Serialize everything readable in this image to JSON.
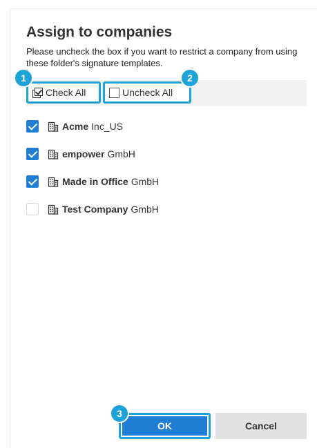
{
  "dialog": {
    "title": "Assign to companies",
    "description": "Please uncheck the box if you want to restrict a company from using these folder's signature templates."
  },
  "toolbar": {
    "check_all_label": "Check All",
    "uncheck_all_label": "Uncheck All"
  },
  "companies": [
    {
      "name": "Acme",
      "suffix": "Inc_US",
      "checked": true
    },
    {
      "name": "empower",
      "suffix": "GmbH",
      "checked": true
    },
    {
      "name": "Made in Office",
      "suffix": "GmbH",
      "checked": true
    },
    {
      "name": "Test Company",
      "suffix": "GmbH",
      "checked": false
    }
  ],
  "buttons": {
    "ok_label": "OK",
    "cancel_label": "Cancel"
  },
  "callouts": {
    "one": "1",
    "two": "2",
    "three": "3"
  },
  "colors": {
    "accent": "#1ea3d8",
    "primary": "#1f7ed4"
  },
  "icons": {
    "check_all": "check-all-icon",
    "uncheck_all": "uncheck-all-icon",
    "company": "building-icon"
  }
}
